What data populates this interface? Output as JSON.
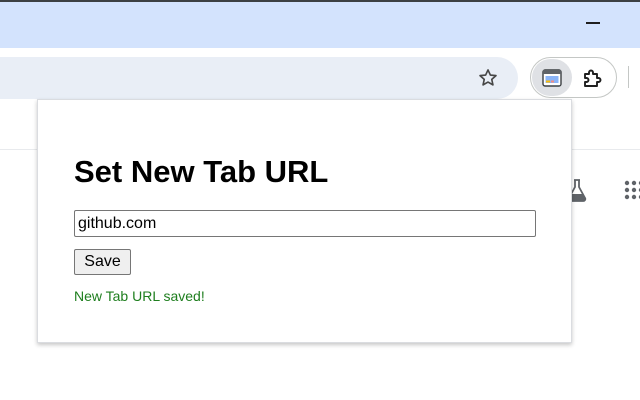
{
  "browser": {
    "window_controls": {
      "minimize_icon": "minimize-icon"
    },
    "toolbar": {
      "bookmark_icon": "star-icon",
      "extension_icon": "newtab-extension-icon",
      "extensions_menu_icon": "puzzle-icon"
    },
    "page": {
      "icons": [
        "flask-icon",
        "apps-grid-icon"
      ]
    }
  },
  "popup": {
    "title": "Set New Tab URL",
    "url_input_value": "github.com",
    "save_label": "Save",
    "status_message": "New Tab URL saved!",
    "status_color": "#1e7e1e"
  }
}
